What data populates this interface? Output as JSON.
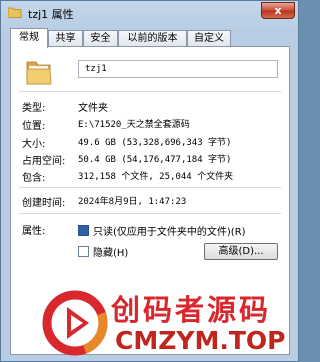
{
  "window": {
    "title": "tzj1 属性",
    "close_glyph": "x"
  },
  "tabs": [
    "常规",
    "共享",
    "安全",
    "以前的版本",
    "自定义"
  ],
  "general": {
    "name_value": "tzj1",
    "rows": {
      "type": {
        "label": "类型:",
        "value": "文件夹"
      },
      "location": {
        "label": "位置:",
        "value": "E:\\71520_天之禁全套源码"
      },
      "size": {
        "label": "大小:",
        "value": "49.6 GB (53,328,696,343 字节)"
      },
      "size_on_disk": {
        "label": "占用空间:",
        "value": "50.4 GB (54,176,477,184 字节)"
      },
      "contains": {
        "label": "包含:",
        "value": "312,158 个文件, 25,044 个文件夹"
      },
      "created": {
        "label": "创建时间:",
        "value": "2024年8月9日, 1:47:23"
      }
    },
    "attributes": {
      "label": "属性:",
      "readonly_label": "只读(仅应用于文件夹中的文件)(R)",
      "hidden_label": "隐藏(H)",
      "advanced_button": "高级(D)..."
    }
  },
  "watermark": {
    "line1": "创码者源码",
    "line2": "CMZYM.TOP"
  },
  "colors": {
    "watermark_red": "#d9272e",
    "folder_yellow": "#e8c35a"
  }
}
